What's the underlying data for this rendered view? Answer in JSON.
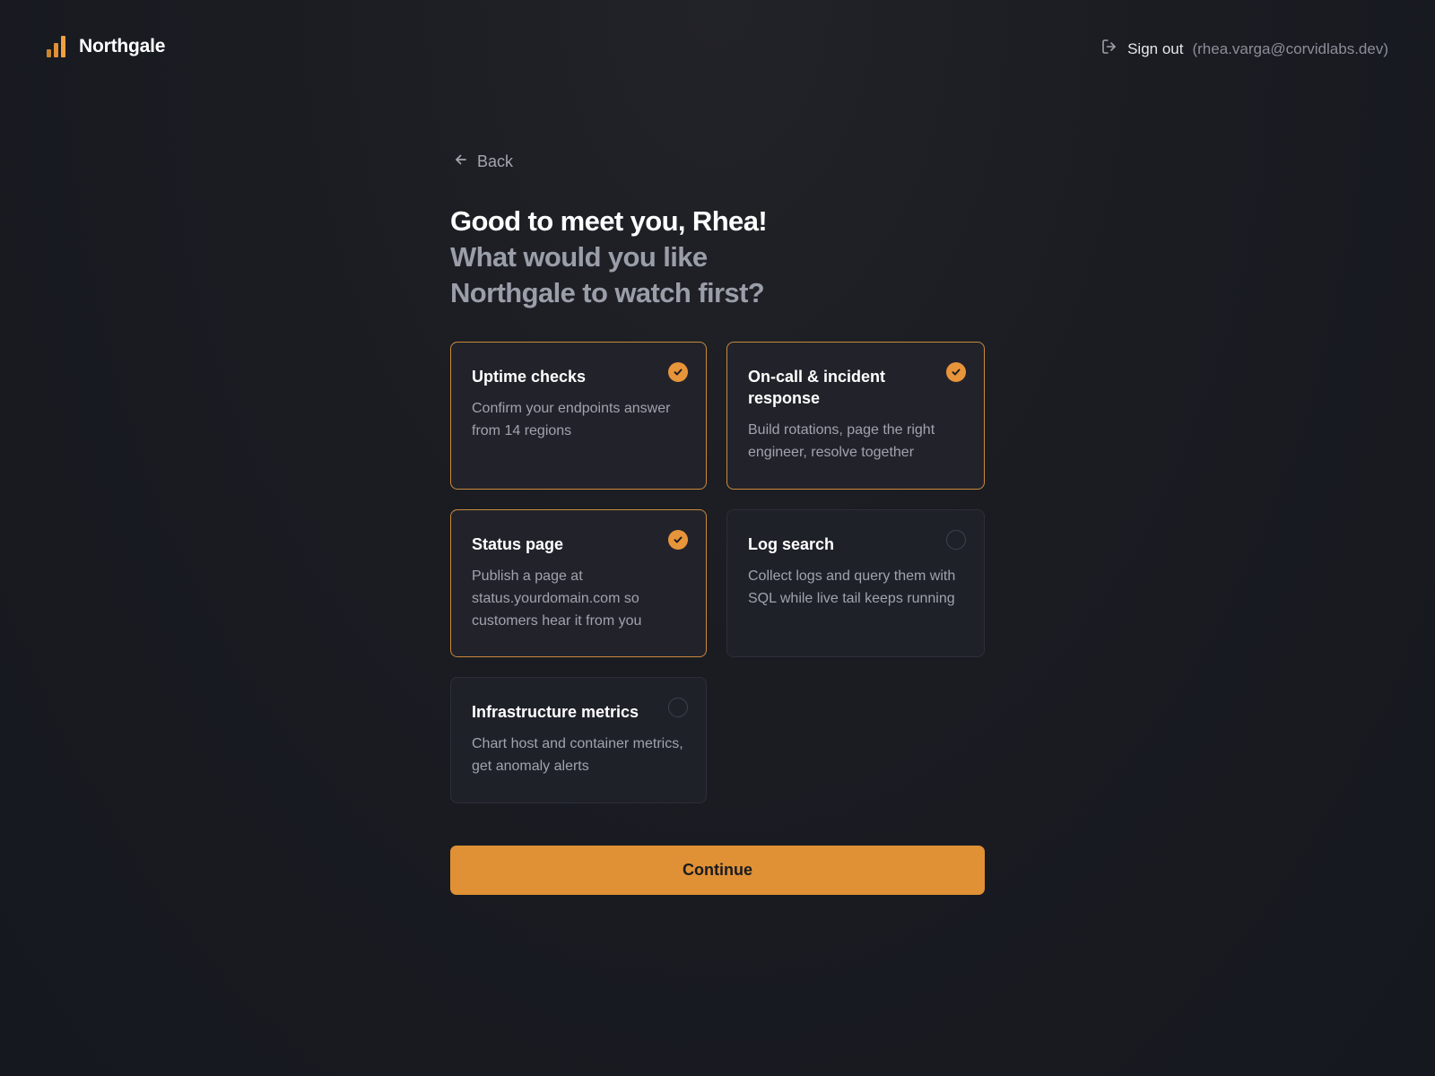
{
  "brand": {
    "name": "Northgale",
    "icon": "bar-chart-logo",
    "colors": [
      "#c9862f",
      "#e09035",
      "#f0a040"
    ]
  },
  "header": {
    "signout_label": "Sign out",
    "signout_email": "(rhea.varga@corvidlabs.dev)",
    "signout_icon": "logout-icon"
  },
  "nav": {
    "back_label": "Back",
    "back_icon": "arrow-left-icon"
  },
  "heading": {
    "line1": "Good to meet you, Rhea!",
    "line2": "What would you like",
    "line3": "Northgale to watch first?"
  },
  "options": [
    {
      "title": "Uptime checks",
      "description": "Confirm your endpoints answer from 14 regions",
      "selected": true
    },
    {
      "title": "On-call & incident response",
      "description": "Build rotations, page the right engineer, resolve together",
      "selected": true
    },
    {
      "title": "Status page",
      "description": "Publish a page at status.yourdomain.com so customers hear it from you",
      "selected": true
    },
    {
      "title": "Log search",
      "description": "Collect logs and query them with SQL while live tail keeps running",
      "selected": false
    },
    {
      "title": "Infrastructure metrics",
      "description": "Chart host and container metrics, get anomaly alerts",
      "selected": false
    }
  ],
  "actions": {
    "continue_label": "Continue"
  },
  "theme": {
    "accent": "#e09035",
    "selected_border": "#c98a3c",
    "background": "#1a1c22"
  }
}
